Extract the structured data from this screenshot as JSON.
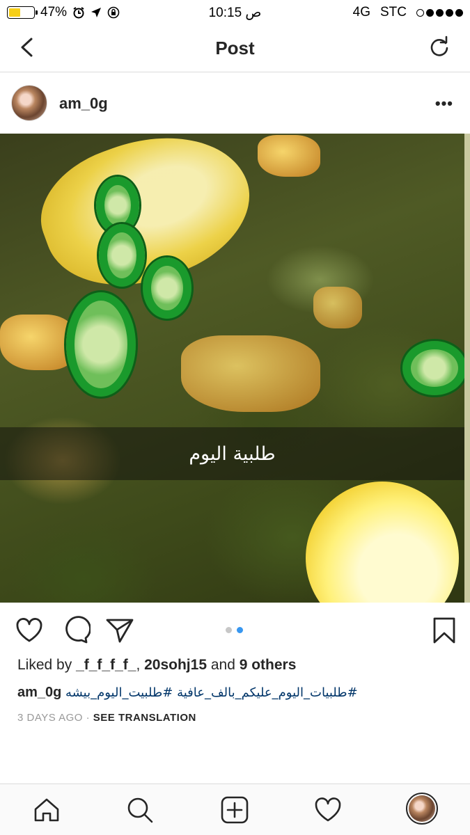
{
  "status_bar": {
    "battery": "47%",
    "time": "10:15 ص",
    "network": "4G",
    "carrier": "STC",
    "battery_level": 0.47,
    "battery_color": "#f7cf18"
  },
  "nav": {
    "title": "Post",
    "back_icon": "chevron-left-icon",
    "refresh_icon": "refresh-icon"
  },
  "post": {
    "username": "am_0g",
    "more_label": "•••",
    "image_caption": "طلبية اليوم",
    "pager": {
      "count": 2,
      "active_index": 1,
      "active_color": "#3897f0"
    }
  },
  "engagement": {
    "liked_by_prefix": "Liked by ",
    "liked_by_user1": "_f_f_f_f_",
    "separator": ", ",
    "liked_by_user2": "20sohj15",
    "and_label": " and ",
    "others": "9 others"
  },
  "caption": {
    "username": "am_0g",
    "text": "#طلبيات_اليوم_عليكم_بالف_عافية #طلبيت_اليوم_بيشه",
    "tag_color": "#003569"
  },
  "meta": {
    "time_ago": "3 DAYS AGO",
    "dot": " · ",
    "see_translation": "SEE TRANSLATION"
  },
  "tabbar": {
    "items": [
      "home-icon",
      "search-icon",
      "add-post-icon",
      "activity-heart-icon",
      "profile-avatar"
    ]
  }
}
